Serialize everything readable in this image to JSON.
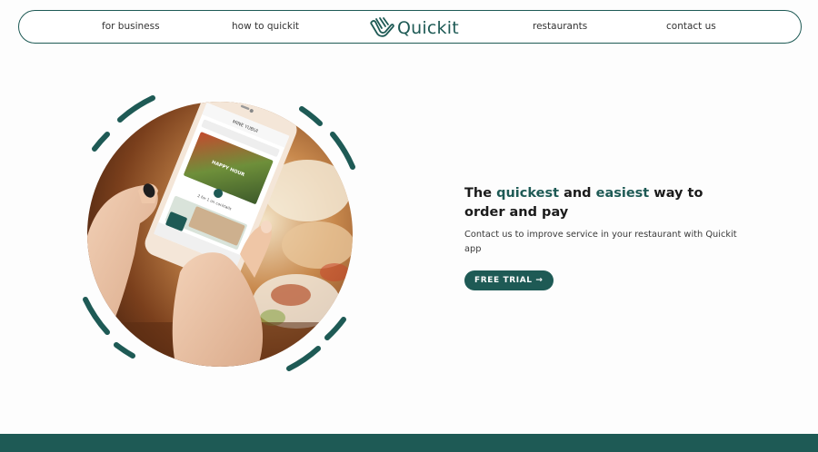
{
  "nav": {
    "links": [
      "for business",
      "how to quickit",
      "restaurants",
      "contact us"
    ],
    "logo_text": "Quickit",
    "logo_icon": "hand-wave-logo-icon"
  },
  "hero": {
    "headline": {
      "part1": "The ",
      "accent1": "quickest",
      "part2": " and ",
      "accent2": "easiest",
      "part3": " way to order and pay"
    },
    "subtext": "Contact us to improve service in your restaurant with Quickit app",
    "cta_label": "FREE TRIAL →",
    "phone_screen": {
      "header": "MINE YUBUI",
      "promo_title": "HAPPY HOUR",
      "promo_caption": "2 for 1 on cocktails"
    }
  },
  "colors": {
    "accent": "#1e5a55",
    "text": "#1b1b1b",
    "background": "#fdfdfd"
  }
}
